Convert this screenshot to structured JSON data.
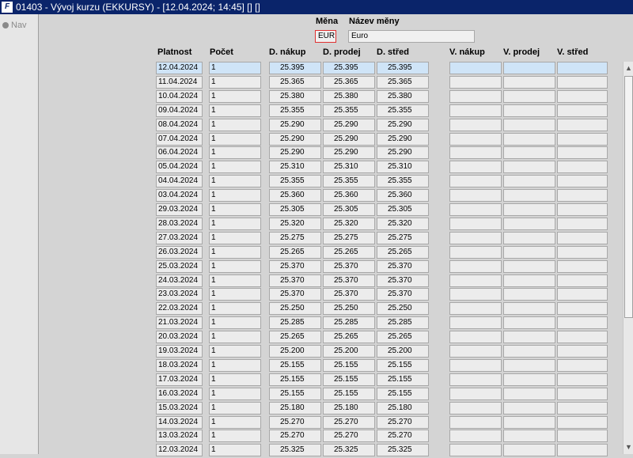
{
  "window": {
    "title": "01403 - Vývoj kurzu (EKKURSY) - [12.04.2024; 14:45] [] []"
  },
  "nav": {
    "label": "Nav"
  },
  "currency": {
    "code_label": "Měna",
    "name_label": "Název měny",
    "code": "EUR",
    "name": "Euro"
  },
  "columns": [
    "Platnost",
    "Počet",
    "D. nákup",
    "D. prodej",
    "D. střed",
    "V. nákup",
    "V. prodej",
    "V. střed"
  ],
  "rows": [
    {
      "date": "12.04.2024",
      "count": "1",
      "buy": "25.395",
      "sell": "25.395",
      "mid": "25.395"
    },
    {
      "date": "11.04.2024",
      "count": "1",
      "buy": "25.365",
      "sell": "25.365",
      "mid": "25.365"
    },
    {
      "date": "10.04.2024",
      "count": "1",
      "buy": "25.380",
      "sell": "25.380",
      "mid": "25.380"
    },
    {
      "date": "09.04.2024",
      "count": "1",
      "buy": "25.355",
      "sell": "25.355",
      "mid": "25.355"
    },
    {
      "date": "08.04.2024",
      "count": "1",
      "buy": "25.290",
      "sell": "25.290",
      "mid": "25.290"
    },
    {
      "date": "07.04.2024",
      "count": "1",
      "buy": "25.290",
      "sell": "25.290",
      "mid": "25.290"
    },
    {
      "date": "06.04.2024",
      "count": "1",
      "buy": "25.290",
      "sell": "25.290",
      "mid": "25.290"
    },
    {
      "date": "05.04.2024",
      "count": "1",
      "buy": "25.310",
      "sell": "25.310",
      "mid": "25.310"
    },
    {
      "date": "04.04.2024",
      "count": "1",
      "buy": "25.355",
      "sell": "25.355",
      "mid": "25.355"
    },
    {
      "date": "03.04.2024",
      "count": "1",
      "buy": "25.360",
      "sell": "25.360",
      "mid": "25.360"
    },
    {
      "date": "29.03.2024",
      "count": "1",
      "buy": "25.305",
      "sell": "25.305",
      "mid": "25.305"
    },
    {
      "date": "28.03.2024",
      "count": "1",
      "buy": "25.320",
      "sell": "25.320",
      "mid": "25.320"
    },
    {
      "date": "27.03.2024",
      "count": "1",
      "buy": "25.275",
      "sell": "25.275",
      "mid": "25.275"
    },
    {
      "date": "26.03.2024",
      "count": "1",
      "buy": "25.265",
      "sell": "25.265",
      "mid": "25.265"
    },
    {
      "date": "25.03.2024",
      "count": "1",
      "buy": "25.370",
      "sell": "25.370",
      "mid": "25.370"
    },
    {
      "date": "24.03.2024",
      "count": "1",
      "buy": "25.370",
      "sell": "25.370",
      "mid": "25.370"
    },
    {
      "date": "23.03.2024",
      "count": "1",
      "buy": "25.370",
      "sell": "25.370",
      "mid": "25.370"
    },
    {
      "date": "22.03.2024",
      "count": "1",
      "buy": "25.250",
      "sell": "25.250",
      "mid": "25.250"
    },
    {
      "date": "21.03.2024",
      "count": "1",
      "buy": "25.285",
      "sell": "25.285",
      "mid": "25.285"
    },
    {
      "date": "20.03.2024",
      "count": "1",
      "buy": "25.265",
      "sell": "25.265",
      "mid": "25.265"
    },
    {
      "date": "19.03.2024",
      "count": "1",
      "buy": "25.200",
      "sell": "25.200",
      "mid": "25.200"
    },
    {
      "date": "18.03.2024",
      "count": "1",
      "buy": "25.155",
      "sell": "25.155",
      "mid": "25.155"
    },
    {
      "date": "17.03.2024",
      "count": "1",
      "buy": "25.155",
      "sell": "25.155",
      "mid": "25.155"
    },
    {
      "date": "16.03.2024",
      "count": "1",
      "buy": "25.155",
      "sell": "25.155",
      "mid": "25.155"
    },
    {
      "date": "15.03.2024",
      "count": "1",
      "buy": "25.180",
      "sell": "25.180",
      "mid": "25.180"
    },
    {
      "date": "14.03.2024",
      "count": "1",
      "buy": "25.270",
      "sell": "25.270",
      "mid": "25.270"
    },
    {
      "date": "13.03.2024",
      "count": "1",
      "buy": "25.270",
      "sell": "25.270",
      "mid": "25.270"
    },
    {
      "date": "12.03.2024",
      "count": "1",
      "buy": "25.325",
      "sell": "25.325",
      "mid": "25.325"
    }
  ],
  "icons": {
    "app": "forms-app-icon",
    "nav": "nav-bullet-icon",
    "scroll_up": "scroll-up-arrow-icon",
    "scroll_down": "scroll-down-arrow-icon"
  },
  "colors": {
    "titlebar": "#0a246a",
    "selected_row": "#cfe4f7",
    "currency_code_border": "#e03030"
  }
}
